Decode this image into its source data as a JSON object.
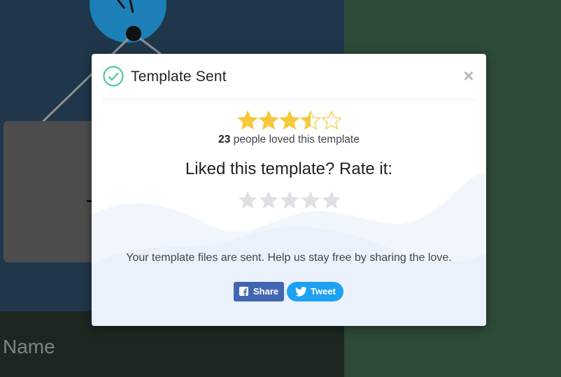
{
  "background": {
    "name_label": "Name"
  },
  "modal": {
    "title": "Template Sent",
    "close_label": "×",
    "average_rating": 3.5,
    "rating_max": 5,
    "loved_count": "23",
    "loved_text": " people loved this template",
    "rate_prompt": "Liked this template? Rate it:",
    "user_rating": 0,
    "sent_message": "Your template files are sent. Help us stay free by sharing the love.",
    "share_label": "Share",
    "tweet_label": "Tweet",
    "icons": {
      "status": "check-circle-icon",
      "close": "close-icon",
      "share": "facebook-icon",
      "tweet": "twitter-icon"
    },
    "colors": {
      "check": "#3ec78b",
      "star_filled": "#f7c83a",
      "star_empty": "#dde0e4",
      "share_bg": "#4267b2",
      "tweet_bg": "#1da1f2"
    }
  }
}
